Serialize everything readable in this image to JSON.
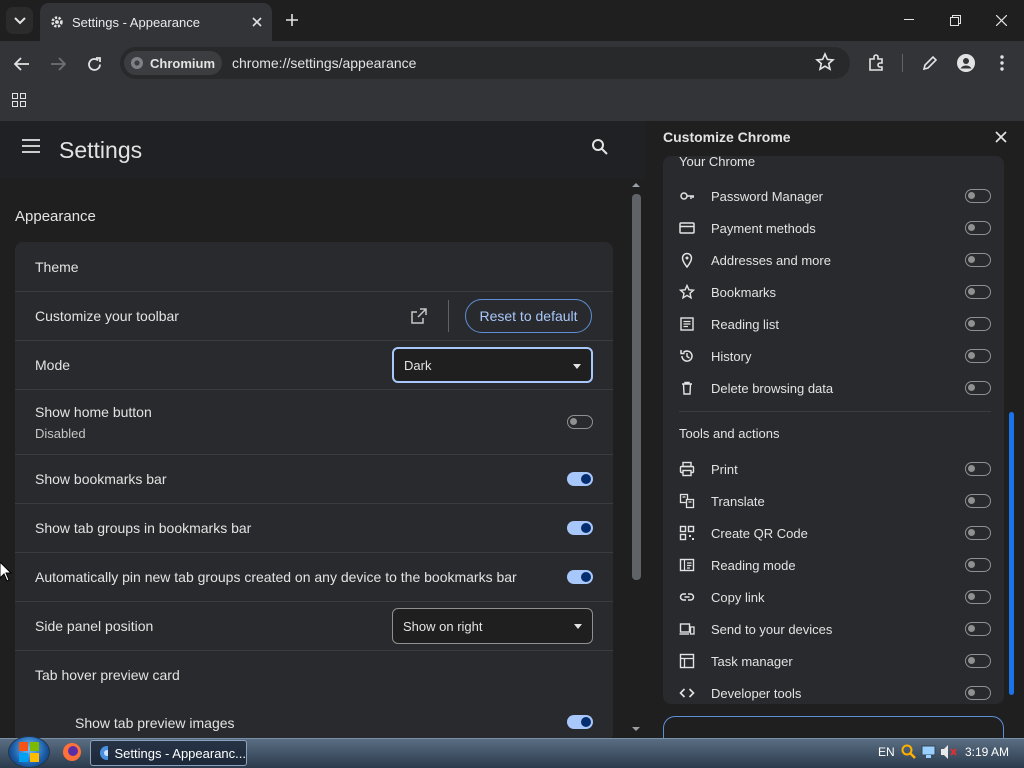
{
  "window": {
    "tab_title": "Settings - Appearance"
  },
  "toolbar": {
    "chip_label": "Chromium",
    "url": "chrome://settings/appearance"
  },
  "settings": {
    "title": "Settings",
    "section": "Appearance",
    "rows": {
      "theme": "Theme",
      "customize_toolbar": "Customize your toolbar",
      "reset_button": "Reset to default",
      "mode": "Mode",
      "mode_value": "Dark",
      "home_button": "Show home button",
      "home_button_sub": "Disabled",
      "home_button_on": false,
      "bookmarks_bar": "Show bookmarks bar",
      "bookmarks_bar_on": true,
      "tab_groups": "Show tab groups in bookmarks bar",
      "tab_groups_on": true,
      "auto_pin": "Automatically pin new tab groups created on any device to the bookmarks bar",
      "auto_pin_on": true,
      "side_panel": "Side panel position",
      "side_panel_value": "Show on right",
      "hover_card": "Tab hover preview card",
      "preview_images": "Show tab preview images",
      "preview_images_on": true
    }
  },
  "side_panel": {
    "title": "Customize Chrome",
    "your_chrome": "Your Chrome",
    "your_chrome_items": [
      {
        "label": "Password Manager",
        "icon": "key-icon",
        "on": false
      },
      {
        "label": "Payment methods",
        "icon": "credit-card-icon",
        "on": false
      },
      {
        "label": "Addresses and more",
        "icon": "location-pin-icon",
        "on": false
      },
      {
        "label": "Bookmarks",
        "icon": "star-icon",
        "on": false
      },
      {
        "label": "Reading list",
        "icon": "reading-list-icon",
        "on": false
      },
      {
        "label": "History",
        "icon": "history-icon",
        "on": false
      },
      {
        "label": "Delete browsing data",
        "icon": "trash-icon",
        "on": false
      }
    ],
    "tools": "Tools and actions",
    "tools_items": [
      {
        "label": "Print",
        "icon": "printer-icon",
        "on": false
      },
      {
        "label": "Translate",
        "icon": "translate-icon",
        "on": false
      },
      {
        "label": "Create QR Code",
        "icon": "qr-code-icon",
        "on": false
      },
      {
        "label": "Reading mode",
        "icon": "reading-mode-icon",
        "on": false
      },
      {
        "label": "Copy link",
        "icon": "link-icon",
        "on": false
      },
      {
        "label": "Send to your devices",
        "icon": "devices-icon",
        "on": false
      },
      {
        "label": "Task manager",
        "icon": "task-manager-icon",
        "on": false
      },
      {
        "label": "Developer tools",
        "icon": "code-icon",
        "on": false
      }
    ]
  },
  "taskbar": {
    "task_label": "Settings - Appearanc...",
    "language": "EN",
    "clock": "3:19 AM"
  },
  "colors": {
    "accent": "#a8c7fa",
    "toggle_on_knob": "#062e6f",
    "background": "#1f1f1f",
    "card": "#292a2d"
  }
}
